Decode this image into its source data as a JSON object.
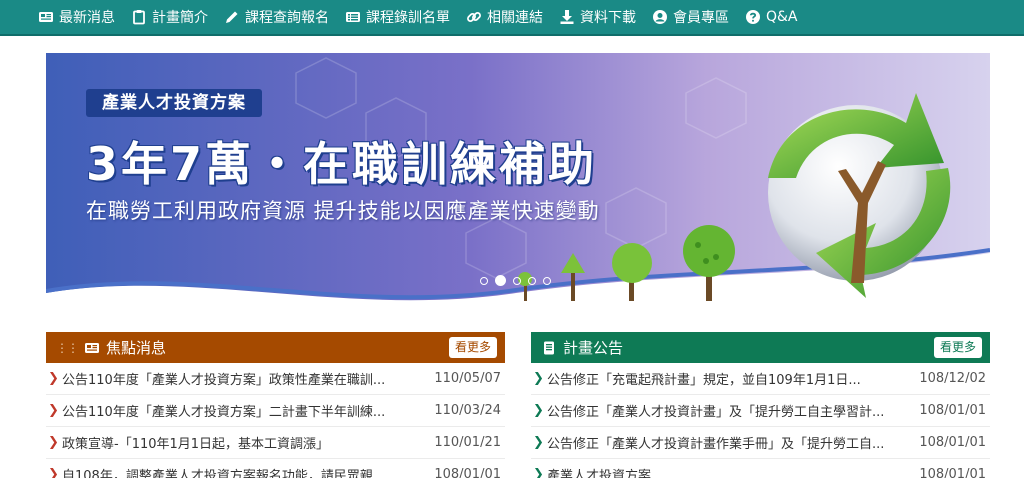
{
  "nav": {
    "items": [
      {
        "label": "最新消息",
        "icon": "newspaper-icon"
      },
      {
        "label": "計畫簡介",
        "icon": "clipboard-icon"
      },
      {
        "label": "課程查詢報名",
        "icon": "pencil-icon"
      },
      {
        "label": "課程錄訓名單",
        "icon": "list-icon"
      },
      {
        "label": "相關連結",
        "icon": "link-icon"
      },
      {
        "label": "資料下載",
        "icon": "download-icon"
      },
      {
        "label": "會員專區",
        "icon": "user-icon"
      },
      {
        "label": "Q&A",
        "icon": "question-icon"
      }
    ]
  },
  "banner": {
    "tagline": "產業人才投資方案",
    "headline": "3年7萬・在職訓練補助",
    "subline": "在職勞工利用政府資源  提升技能以因應產業快速變動",
    "slides_total": 5,
    "active_slide": 2
  },
  "focus_news": {
    "title": "焦點消息",
    "more_label": "看更多",
    "icon": "newspaper-icon",
    "items": [
      {
        "title": "公告110年度「產業人才投資方案」政策性產業在職訓...",
        "date": "110/05/07"
      },
      {
        "title": "公告110年度「產業人才投資方案」二計畫下半年訓練...",
        "date": "110/03/24"
      },
      {
        "title": "政策宣導-「110年1月1日起，基本工資調漲」",
        "date": "110/01/21"
      },
      {
        "title": "自108年，調整產業人才投資方案報名功能，請民眾親...",
        "date": "108/01/01"
      }
    ]
  },
  "plan_notices": {
    "title": "計畫公告",
    "more_label": "看更多",
    "icon": "document-icon",
    "items": [
      {
        "title": "公告修正「充電起飛計畫」規定，並自109年1月1日...",
        "date": "108/12/02"
      },
      {
        "title": "公告修正「產業人才投資計畫」及「提升勞工自主學習計...",
        "date": "108/01/01"
      },
      {
        "title": "公告修正「產業人才投資計畫作業手冊」及「提升勞工自...",
        "date": "108/01/01"
      },
      {
        "title": "產業人才投資方案",
        "date": "108/01/01"
      }
    ]
  },
  "colors": {
    "nav_bg": "#1a8a86",
    "focus_header": "#a54a00",
    "notice_header": "#0e7a55",
    "tagline_bg": "#1f3f8f"
  }
}
